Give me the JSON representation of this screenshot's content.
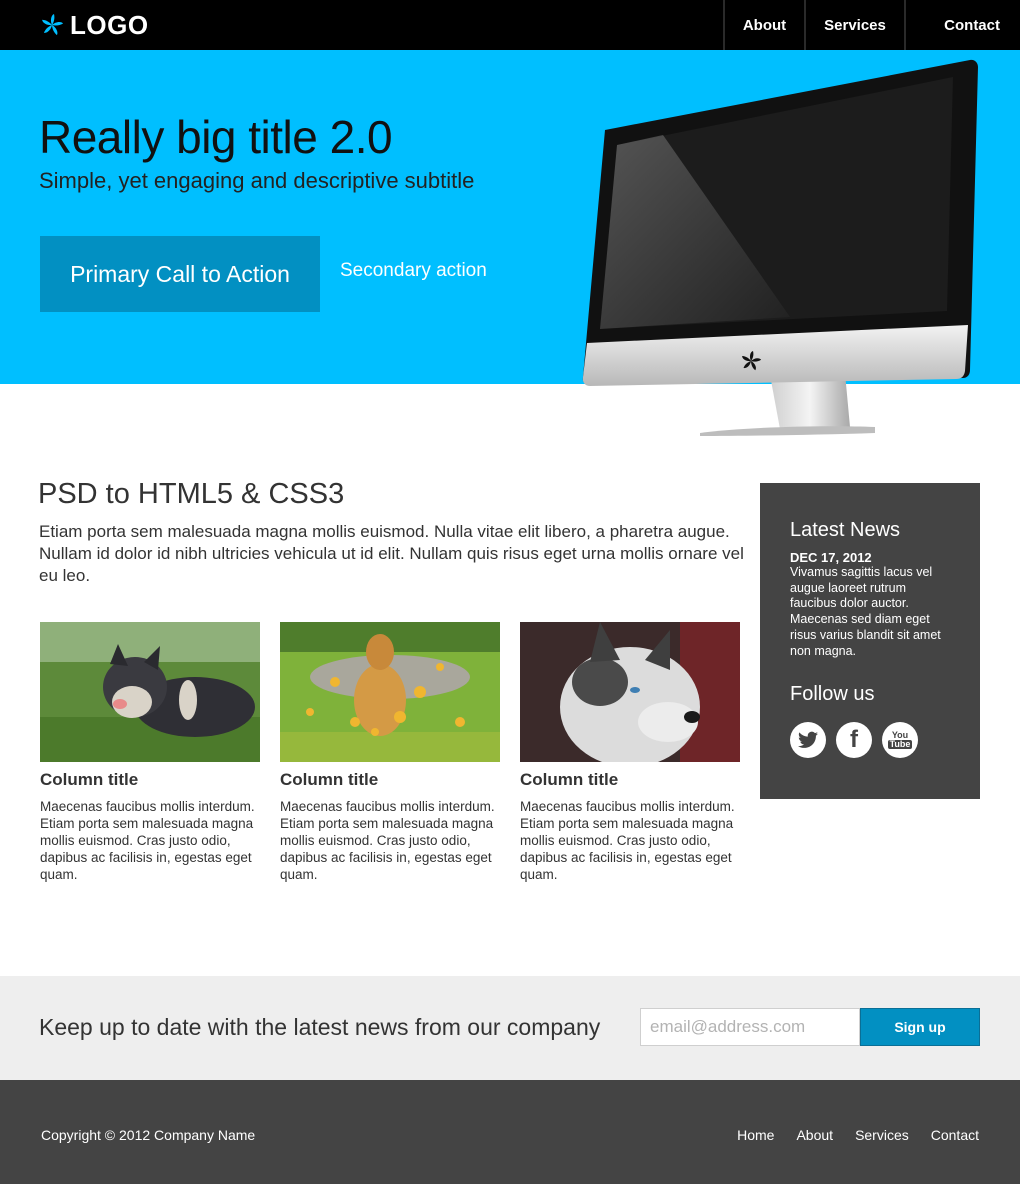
{
  "header": {
    "logo_text": "LOGO",
    "logo_icon": "pinwheel-icon",
    "nav": [
      {
        "label": "About"
      },
      {
        "label": "Services"
      },
      {
        "label": "Contact"
      }
    ]
  },
  "hero": {
    "title": "Really big title 2.0",
    "subtitle": "Simple, yet engaging and descriptive subtitle",
    "primary_cta": "Primary Call to Action",
    "secondary_cta": "Secondary action",
    "bg_color": "#00bfff",
    "image": "monitor-image"
  },
  "main": {
    "title": "PSD to HTML5 & CSS3",
    "intro": "Etiam porta sem malesuada magna mollis euismod. Nulla vitae elit libero, a pharetra augue. Nullam id dolor id nibh ultricies vehicula ut id elit. Nullam quis risus eget urna mollis ornare vel eu leo.",
    "columns": [
      {
        "title": "Column title",
        "text": "Maecenas faucibus mollis interdum. Etiam porta sem malesuada magna mollis euismod. Cras justo odio, dapibus ac facilisis in, egestas eget quam.",
        "image": "puppy-on-grass-photo"
      },
      {
        "title": "Column title",
        "text": "Maecenas faucibus mollis interdum. Etiam porta sem malesuada magna mollis euismod. Cras justo odio, dapibus ac facilisis in, egestas eget quam.",
        "image": "dog-in-leaves-photo"
      },
      {
        "title": "Column title",
        "text": "Maecenas faucibus mollis interdum. Etiam porta sem malesuada magna mollis euismod. Cras justo odio, dapibus ac facilisis in, egestas eget quam.",
        "image": "husky-photo"
      }
    ]
  },
  "sidebar": {
    "news_title": "Latest News",
    "news_date": "DEC 17, 2012",
    "news_text": "Vivamus sagittis lacus vel augue laoreet rutrum faucibus dolor auctor. Maecenas sed diam eget risus varius blandit sit amet non magna.",
    "follow_title": "Follow us",
    "social": [
      {
        "icon": "twitter-icon"
      },
      {
        "icon": "facebook-icon",
        "glyph": "f"
      },
      {
        "icon": "youtube-icon",
        "glyph_top": "You",
        "glyph_bottom": "Tube"
      }
    ]
  },
  "newsletter": {
    "text": "Keep up to date with the latest news from our company",
    "email_placeholder": "email@address.com",
    "signup_label": "Sign up"
  },
  "footer": {
    "copyright": "Copyright © 2012 Company Name",
    "links": [
      {
        "label": "Home"
      },
      {
        "label": "About"
      },
      {
        "label": "Services"
      },
      {
        "label": "Contact"
      }
    ]
  },
  "colors": {
    "accent": "#00bfff",
    "button": "#0290c2",
    "dark": "#444444",
    "header": "#000000"
  }
}
